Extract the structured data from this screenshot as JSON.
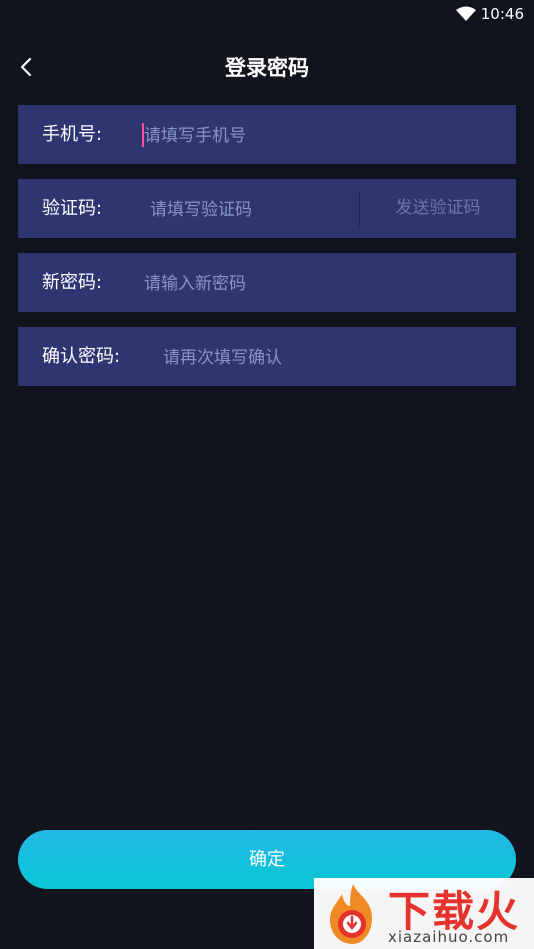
{
  "status_bar": {
    "time": "10:46",
    "wifi_icon": "wifi-icon"
  },
  "header": {
    "title": "登录密码",
    "back_icon": "chevron-left-icon"
  },
  "form": {
    "phone": {
      "label": "手机号:",
      "placeholder": "请填写手机号",
      "value": ""
    },
    "code": {
      "label": "验证码:",
      "placeholder": "请填写验证码",
      "value": "",
      "send_label": "发送验证码"
    },
    "new_password": {
      "label": "新密码:",
      "placeholder": "请输入新密码",
      "value": ""
    },
    "confirm_password": {
      "label": "确认密码:",
      "placeholder": "请再次填写确认",
      "value": ""
    }
  },
  "confirm_label": "确定",
  "watermark": {
    "title": "下载火",
    "url": "xiazaihuo.com"
  },
  "colors": {
    "background": "#12141d",
    "row_bg": "#2e3571",
    "placeholder": "#8a93c9",
    "button_gradient_top": "#23b8e6",
    "button_gradient_bottom": "#08c7d4",
    "cursor": "#ff4fa0"
  }
}
